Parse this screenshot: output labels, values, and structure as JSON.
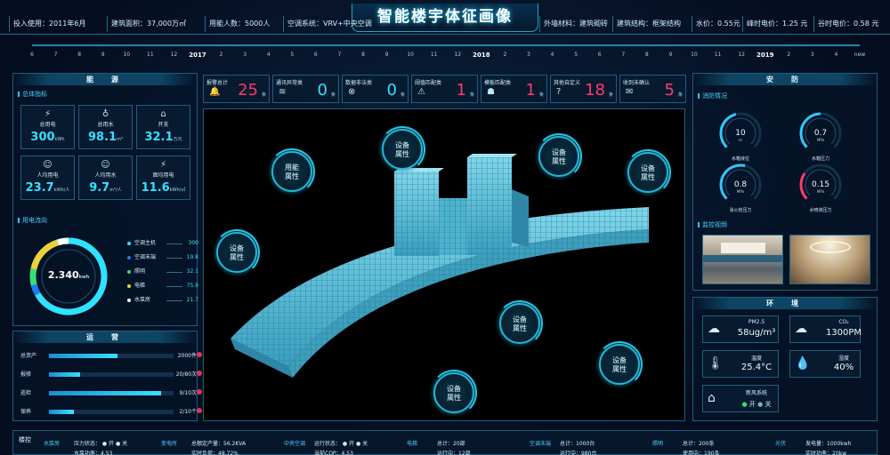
{
  "title": "智能楼宇体征画像",
  "info_left": [
    "投入使用：2011年6月",
    "建筑面积：37,000万㎡",
    "用能人数：5000人",
    "空调系统：VRV+中央空调"
  ],
  "info_right": [
    "外墙材料：建筑砌砖",
    "建筑结构：框架结构",
    "水价：0.55元",
    "峰时电价：1.25 元",
    "谷时电价：0.58 元"
  ],
  "timeline": {
    "ticks": [
      "6",
      "7",
      "8",
      "9",
      "10",
      "11",
      "12",
      "2017",
      "2",
      "3",
      "4",
      "5",
      "6",
      "7",
      "8",
      "9",
      "10",
      "11",
      "12",
      "2018",
      "2",
      "3",
      "4",
      "5",
      "6",
      "7",
      "8",
      "9",
      "10",
      "11",
      "12",
      "2019",
      "2",
      "3",
      "4",
      "new"
    ],
    "selected_label": "4"
  },
  "energy": {
    "heading": "能　源",
    "overall_label": "总体指标",
    "cells": [
      {
        "icon": "⚡",
        "label": "总用电",
        "value": "300",
        "unit": "kWh"
      },
      {
        "icon": "♁",
        "label": "总用水",
        "value": "98.1",
        "unit": "m³"
      },
      {
        "icon": "⌂",
        "label": "开支",
        "value": "32.1",
        "unit": "万元"
      },
      {
        "icon": "☺",
        "label": "人均用电",
        "value": "23.7",
        "unit": "kWh/人"
      },
      {
        "icon": "☺",
        "label": "人均用水",
        "value": "9.7",
        "unit": "m³/人"
      },
      {
        "icon": "⚡",
        "label": "面均用电",
        "value": "11.6",
        "unit": "kWh/㎡"
      }
    ],
    "flow_label": "用电流向",
    "donut_value": "2.340",
    "donut_unit": "kwh",
    "legend": [
      {
        "name": "空调主机",
        "value": "300",
        "color": "#2fe3ff"
      },
      {
        "name": "空调末端",
        "value": "19.8",
        "color": "#1c7cf0"
      },
      {
        "name": "照明",
        "value": "32.1",
        "color": "#33e07a"
      },
      {
        "name": "电梯",
        "value": "75.9",
        "color": "#e8d43a"
      },
      {
        "name": "水泵房",
        "value": "21.7",
        "color": "#ffffff"
      }
    ]
  },
  "ops": {
    "heading": "运　营",
    "rows": [
      {
        "label": "总资产",
        "value": "2000件",
        "fill": 0.55
      },
      {
        "label": "报修",
        "value": "20/80次",
        "fill": 0.25
      },
      {
        "label": "巡检",
        "value": "9/10次",
        "fill": 0.9
      },
      {
        "label": "保养",
        "value": "2/10个",
        "fill": 0.2
      }
    ]
  },
  "alerts": [
    {
      "label": "报警总计",
      "icon": "🔔",
      "value": "25",
      "unit": "条",
      "red": true
    },
    {
      "label": "通讯异常类",
      "icon": "≋",
      "value": "0",
      "unit": "条",
      "red": false
    },
    {
      "label": "数据非法类",
      "icon": "⊗",
      "value": "0",
      "unit": "条",
      "red": false
    },
    {
      "label": "阈值匹配类",
      "icon": "⚠",
      "value": "1",
      "unit": "条",
      "red": true
    },
    {
      "label": "模板匹配类",
      "icon": "☗",
      "value": "1",
      "unit": "条",
      "red": true
    },
    {
      "label": "其他自定义",
      "icon": "?",
      "value": "18",
      "unit": "条",
      "red": true
    },
    {
      "label": "收到未确认",
      "icon": "✉",
      "value": "5",
      "unit": "条",
      "red": true
    }
  ],
  "bubbles": [
    {
      "text": "用能\n属性"
    },
    {
      "text": "设备\n属性"
    },
    {
      "text": "设备\n属性"
    },
    {
      "text": "设备\n属性"
    },
    {
      "text": "设备\n属性"
    },
    {
      "text": "设备\n属性"
    },
    {
      "text": "设备\n属性"
    },
    {
      "text": "设备\n属性"
    }
  ],
  "security": {
    "heading": "安　防",
    "fire_label": "消防情况",
    "gauges": [
      {
        "value": "10",
        "unit": "m",
        "name": "水箱液位",
        "color": "#2fc8ff",
        "level": 0.45
      },
      {
        "value": "0.7",
        "unit": "MPa",
        "name": "水箱压力",
        "color": "#2fc8ff",
        "level": 0.5
      },
      {
        "value": "0.8",
        "unit": "MPa",
        "name": "消火栓压力",
        "color": "#2fc8ff",
        "level": 0.55
      },
      {
        "value": "0.15",
        "unit": "MPa",
        "name": "水喷淋压力",
        "color": "#ff3a6c",
        "level": 0.3
      }
    ],
    "video_label": "监控视频"
  },
  "environment": {
    "heading": "环　境",
    "cells": [
      {
        "icon": "☁",
        "label": "PM2.5",
        "value": "58ug/m³"
      },
      {
        "icon": "☁",
        "label": "CO₂",
        "value": "1300PM"
      },
      {
        "icon": "🌡",
        "label": "温度",
        "value": "25.4°C"
      },
      {
        "icon": "💧",
        "label": "湿度",
        "value": "40%"
      }
    ],
    "fresh_air": {
      "icon": "⌂",
      "label": "新风系统",
      "on": "开",
      "off": "关"
    }
  },
  "bottom": {
    "head": "楼控",
    "segments": [
      {
        "name": "水泵房",
        "l1": "压力状态： ● 开 ● 关",
        "l2": "水泵功率：4.53"
      },
      {
        "name": "变电所",
        "l1": "总额定产量：56.2KVA",
        "l2": "实时负荷：48.72%"
      },
      {
        "name": "中央空调",
        "l1": "运行状态： ● 开 ● 关",
        "l2": "当前COP：4.53"
      },
      {
        "name": "电梯",
        "l1": "总计：20部",
        "l2": "运行中：12部"
      },
      {
        "name": "空调末端",
        "l1": "总计：1000台",
        "l2": "运行中：980台"
      },
      {
        "name": "照明",
        "l1": "总计：200条",
        "l2": "使用中：190条"
      },
      {
        "name": "光伏",
        "l1": "发电量：1000kwh",
        "l2": "实时功率：20kw"
      }
    ]
  }
}
